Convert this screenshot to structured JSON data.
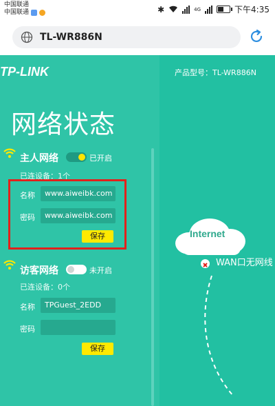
{
  "status_bar": {
    "carrier_1": "中国联通",
    "carrier_2": "中国联通",
    "network_badges": "4G",
    "time": "下午4:35"
  },
  "browser": {
    "url": "TL-WR886N"
  },
  "header": {
    "logo": "TP-LINK",
    "model": "产品型号：TL-WR886N"
  },
  "page_title": "网络状态",
  "main_network": {
    "title": "主人网络",
    "toggle_state": "已开启",
    "connected": "已连设备：1个",
    "name_label": "名称",
    "name_value": "www.aiweibk.com",
    "password_label": "密码",
    "password_value": "www.aiweibk.com",
    "save": "保存"
  },
  "guest_network": {
    "title": "访客网络",
    "toggle_state": "未开启",
    "connected": "已连设备：0个",
    "name_label": "名称",
    "name_value": "TPGuest_2EDD",
    "password_label": "密码",
    "password_value": "",
    "save": "保存"
  },
  "diagram": {
    "internet": "Internet",
    "wan_status": "WAN口无网线"
  },
  "colors": {
    "page_bg": "#2fc4a7",
    "save_button": "#ffe900",
    "toggle_on_knob": "#ffe600",
    "highlight_box": "#e3211b"
  }
}
